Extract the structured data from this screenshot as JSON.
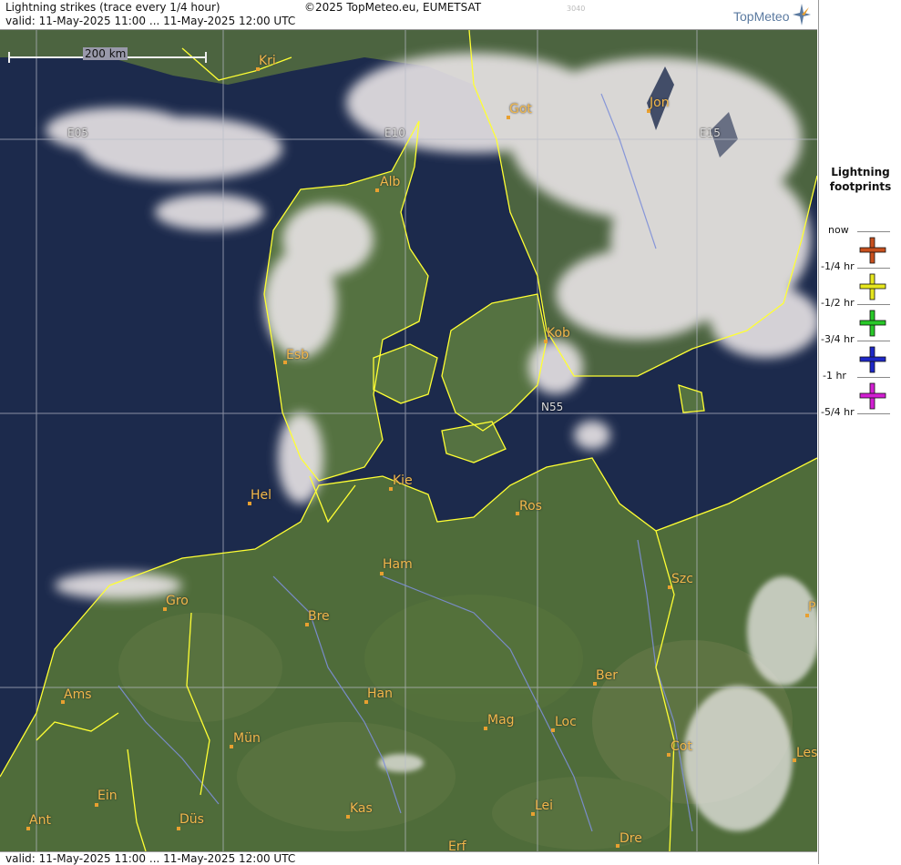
{
  "header": {
    "title": "Lightning strikes (trace every 1/4 hour)",
    "valid": "valid:  11-May-2025 11:00 ... 11-May-2025 12:00 UTC",
    "copyright": "©2025 TopMeteo.eu, EUMETSAT",
    "code": "3040",
    "logo": "TopMeteo"
  },
  "footer": {
    "valid": "valid:  11-May-2025 11:00 ... 11-May-2025 12:00 UTC"
  },
  "map": {
    "scale_label": "200 km",
    "grid_labels": {
      "e05": "E05",
      "e10": "E10",
      "e15": "E15",
      "n55": "N55"
    },
    "cities": [
      "Kri",
      "Got",
      "Jon",
      "Alb",
      "Kob",
      "Esb",
      "Kie",
      "Hel",
      "Ros",
      "Ham",
      "Szc",
      "Gro",
      "Bre",
      "P",
      "Ber",
      "Ams",
      "Han",
      "Mag",
      "Loc",
      "Mün",
      "Cot",
      "Les",
      "Ein",
      "Kas",
      "Lei",
      "Ant",
      "Düs",
      "Dre",
      "Erf"
    ]
  },
  "legend": {
    "title_line1": "Lightning",
    "title_line2": "footprints",
    "items": [
      {
        "label": "now",
        "color": "#c8501e"
      },
      {
        "label": "-1/4 hr",
        "color": "#e6e61e"
      },
      {
        "label": "-1/2 hr",
        "color": "#28c828"
      },
      {
        "label": "-3/4 hr",
        "color": "#1e28c8"
      },
      {
        "label": "-1 hr",
        "color": "#d21ed2"
      },
      {
        "label": "-5/4 hr",
        "color": ""
      }
    ]
  },
  "colors": {
    "sea": "#1c2a4c",
    "land": "#4f6c3a",
    "border": "#ffff33",
    "river": "#7d8fd8"
  }
}
